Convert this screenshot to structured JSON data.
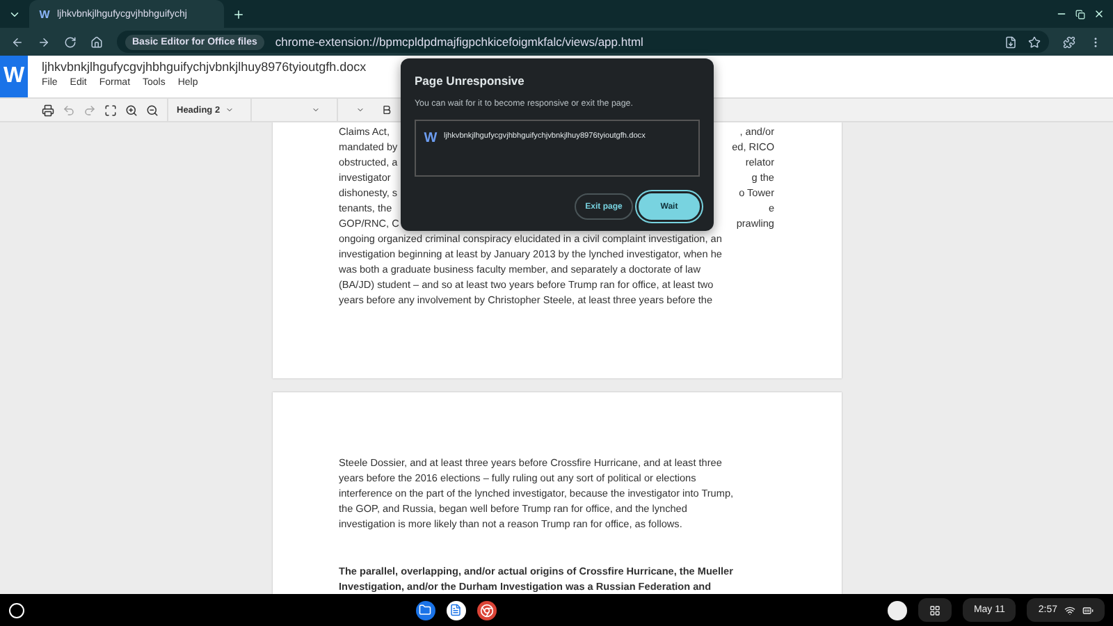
{
  "browser": {
    "tab": {
      "icon": "W",
      "title": "ljhkvbnkjlhgufycgvjhbhguifychj",
      "selected": true
    },
    "site_chip": "Basic Editor for Office files",
    "url": "chrome-extension://bpmcpldpdmajfigpchkicefoigmkfalc/views/app.html"
  },
  "app": {
    "logo": "W",
    "title": "ljhkvbnkjlhgufycgvjhbhguifychjvbnkjlhuy8976tyioutgfh.docx",
    "menu": [
      "File",
      "Edit",
      "Format",
      "Tools",
      "Help"
    ],
    "style_select": "Heading 2"
  },
  "pages": [
    {
      "lines": [
        {
          "left": "Claims Act,",
          "right": ", and/or"
        },
        {
          "left": "mandated by",
          "right": "ed, RICO"
        },
        {
          "left": "obstructed, a",
          "right": "relator"
        },
        {
          "left": "investigator",
          "right": "g the"
        },
        {
          "left": "dishonesty, s",
          "right": "o Tower"
        },
        {
          "left": "tenants, the",
          "right": "e"
        },
        {
          "left": "GOP/RNC, C",
          "right": "prawling"
        },
        {
          "left": "ongoing organized criminal conspiracy elucidated in a civil complaint investigation, an"
        },
        {
          "left": "investigation beginning at least by January 2013 by the lynched investigator, when he"
        },
        {
          "left": "was both a graduate business faculty member, and separately a doctorate of law"
        },
        {
          "left": "(BA/JD) student – and so at least two years before Trump ran for office, at least two"
        },
        {
          "left": "years before any involvement by Christopher Steele, at least three years before the"
        }
      ]
    },
    {
      "lines": [
        {
          "left": "Steele Dossier, and at least three years before Crossfire Hurricane, and at least three"
        },
        {
          "left": "years before the 2016 elections – fully ruling out any sort of political or elections"
        },
        {
          "left": "interference on the part of the lynched investigator, because the investigator into Trump,"
        },
        {
          "left": "the GOP, and Russia, began well before Trump ran for office, and the lynched"
        },
        {
          "left": "investigation is more likely than not a reason Trump ran for office, as follows."
        }
      ],
      "heading": [
        "The parallel, overlapping, and/or actual origins of Crossfire Hurricane, the Mueller",
        "Investigation, and/or the Durham Investigation was a Russian Federation and"
      ]
    }
  ],
  "dialog": {
    "title": "Page Unresponsive",
    "message": "You can wait for it to become responsive or exit the page.",
    "page_icon": "W",
    "page_name": "ljhkvbnkjlhgufycgvjhbhguifychjvbnkjlhuy8976tyioutgfh.docx",
    "buttons": [
      {
        "label": "Exit page",
        "selected": false
      },
      {
        "label": "Wait",
        "selected": true
      }
    ]
  },
  "taskbar": {
    "date": "May 11",
    "time": "2:57"
  }
}
